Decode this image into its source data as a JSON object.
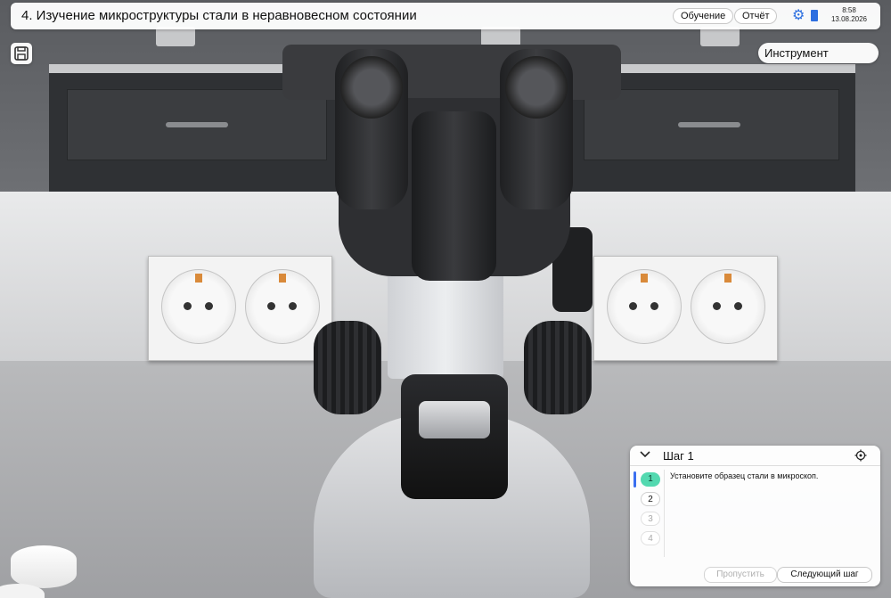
{
  "header": {
    "title": "4. Изучение микроструктуры стали в неравновесном состоянии",
    "training_label": "Обучение",
    "report_label": "Отчёт",
    "time": "8:58",
    "date": "13.08.2026"
  },
  "tool_label": "Инструмент",
  "step_panel": {
    "title": "Шаг 1",
    "steps": [
      "1",
      "2",
      "3",
      "4"
    ],
    "active_step": 1,
    "instruction": "Установите образец стали в микроскоп.",
    "skip_label": "Пропустить",
    "next_label": "Следующий шаг"
  },
  "icons": [
    "save-icon",
    "gear-icon",
    "book-icon",
    "chevron-down-icon",
    "target-icon"
  ],
  "colors": {
    "accent": "#2d6fe0",
    "active_step": "#53d9b0",
    "active_bar": "#3b6ff0"
  }
}
